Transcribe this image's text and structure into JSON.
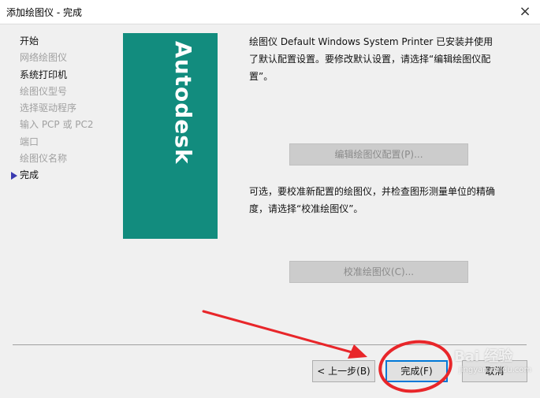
{
  "window": {
    "title": "添加绘图仪 - 完成",
    "close_icon": "×"
  },
  "steps": [
    {
      "label": "开始",
      "state": "done"
    },
    {
      "label": "网络绘图仪",
      "state": "disabled"
    },
    {
      "label": "系统打印机",
      "state": "done"
    },
    {
      "label": "绘图仪型号",
      "state": "disabled"
    },
    {
      "label": "选择驱动程序",
      "state": "disabled"
    },
    {
      "label": "输入 PCP 或 PC2",
      "state": "disabled"
    },
    {
      "label": "端口",
      "state": "disabled"
    },
    {
      "label": "绘图仪名称",
      "state": "disabled"
    },
    {
      "label": "完成",
      "state": "current"
    }
  ],
  "brand": {
    "name": "Autodesk",
    "color": "#128c7e"
  },
  "content": {
    "message1": "绘图仪 Default Windows System Printer 已安装并使用了默认配置设置。要修改默认设置，请选择“编辑绘图仪配置”。",
    "edit_button": "编辑绘图仪配置(P)...",
    "message2": "可选，要校准新配置的绘图仪，并检查图形测量单位的精确度，请选择“校准绘图仪”。",
    "calibrate_button": "校准绘图仪(C)..."
  },
  "footer": {
    "back": "< 上一步(B)",
    "finish": "完成(F)",
    "cancel": "取消"
  },
  "annotation": {
    "color": "#e8262a"
  },
  "watermark": {
    "text": "Bai 经验",
    "url": "jingyan.baidu.com"
  }
}
